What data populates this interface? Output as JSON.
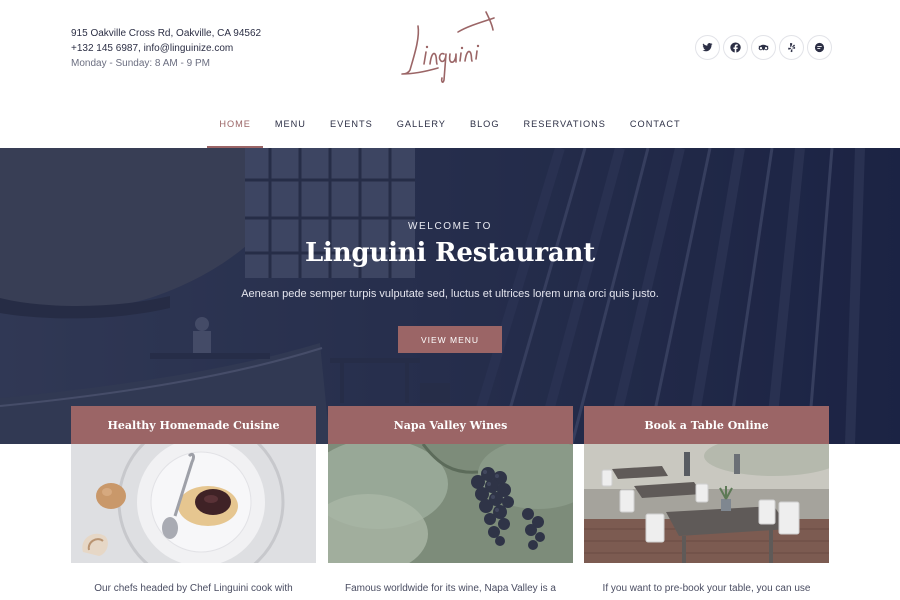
{
  "header": {
    "address": "915 Oakville Cross Rd, Oakville, CA 94562",
    "phone": "+132 145 6987,",
    "email": "info@linguinize.com",
    "hours": "Monday - Sunday: 8 AM - 9 PM",
    "logo_text": "Linguini"
  },
  "social": [
    {
      "icon": "twitter-icon"
    },
    {
      "icon": "facebook-icon"
    },
    {
      "icon": "tripadvisor-icon"
    },
    {
      "icon": "yelp-icon"
    },
    {
      "icon": "foursquare-icon"
    }
  ],
  "nav": {
    "items": [
      {
        "label": "HOME",
        "active": true
      },
      {
        "label": "MENU"
      },
      {
        "label": "EVENTS"
      },
      {
        "label": "GALLERY"
      },
      {
        "label": "BLOG"
      },
      {
        "label": "RESERVATIONS"
      },
      {
        "label": "CONTACT"
      }
    ]
  },
  "hero": {
    "kicker": "WELCOME TO",
    "title": "Linguini Restaurant",
    "subtitle": "Aenean pede semper turpis vulputate sed, luctus et ultrices lorem urna orci quis justo.",
    "button": "VIEW MENU"
  },
  "cards": [
    {
      "title": "Healthy Homemade Cuisine",
      "text": "Our chefs headed by Chef Linguini cook with"
    },
    {
      "title": "Napa Valley Wines",
      "text": "Famous worldwide for its wine, Napa Valley is a"
    },
    {
      "title": "Book a Table Online",
      "text": "If you want to pre-book your table, you can use"
    }
  ],
  "colors": {
    "accent": "#9b6566",
    "text": "#2c2f45",
    "hero_overlay": "#1f2747"
  }
}
